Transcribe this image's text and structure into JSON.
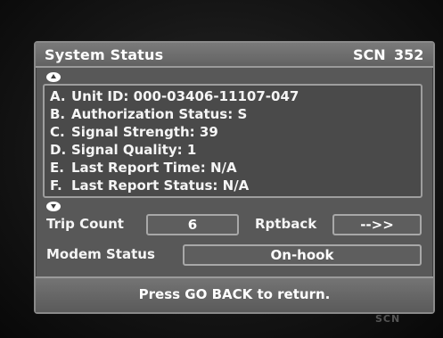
{
  "header": {
    "title": "System Status",
    "scn_label": "SCN",
    "scn_number": "352"
  },
  "scroll": {
    "up_icon": "scroll-up-arrow-icon",
    "down_icon": "scroll-down-arrow-icon"
  },
  "status_list": [
    {
      "letter": "A.",
      "text": "Unit ID: 000-03406-11107-047"
    },
    {
      "letter": "B.",
      "text": "Authorization Status: S"
    },
    {
      "letter": "C.",
      "text": "Signal Strength: 39"
    },
    {
      "letter": "D.",
      "text": "Signal Quality: 1"
    },
    {
      "letter": "E.",
      "text": "Last Report Time: N/A"
    },
    {
      "letter": "F.",
      "text": "Last Report Status: N/A"
    }
  ],
  "fields": {
    "trip_count_label": "Trip Count",
    "trip_count_value": "6",
    "rptback_label": "Rptback",
    "rptback_value": "-->>",
    "modem_status_label": "Modem Status",
    "modem_status_value": "On-hook"
  },
  "footer": {
    "instruction": "Press GO BACK to return."
  },
  "watermark": "SCN",
  "colors": {
    "panel": "#585858",
    "border": "#9e9e9e",
    "text": "#f5f5f5"
  }
}
